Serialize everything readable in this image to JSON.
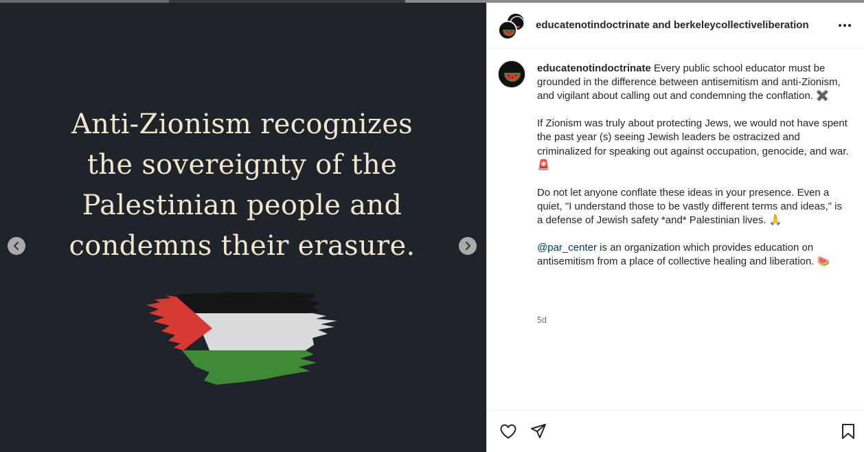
{
  "slide": {
    "quote_lines": [
      "Anti-Zionism recognizes",
      "the sovereignty of the",
      "Palestinian people and",
      "condemns their erasure."
    ],
    "flag_icon": "palestine-flag-brush-icon",
    "colors": {
      "background": "#1f232a",
      "quote_text": "#f3e6cf",
      "flag_black": "#151515",
      "flag_white": "#d9dadb",
      "flag_green": "#3f8a36",
      "flag_red": "#d63a33"
    }
  },
  "nav": {
    "prev_icon": "chevron-left-icon",
    "next_icon": "chevron-right-icon"
  },
  "header": {
    "user1": "educatenotindoctrinate",
    "connector": "and",
    "user2": "berkeleycollectiveliberation",
    "more_icon": "more-options-icon"
  },
  "caption": {
    "username": "educatenotindoctrinate",
    "p1_text": "Every public school educator must be grounded in the difference between antisemitism and anti-Zionism, and vigilant about calling out and condemning the conflation.",
    "p1_emoji": "✖️",
    "p2_text": "If Zionism was truly about protecting Jews, we would not have spent the past year (s) seeing Jewish leaders be ostracized and criminalized for speaking out against occupation, genocide, and war.",
    "p2_emoji": "🚨",
    "p3_text": "Do not let anyone conflate these ideas in your presence. Even a quiet, \"I understand those to be vastly different terms and ideas,\" is a defense of Jewish safety *and* Palestinian lives.",
    "p3_emoji": "🙏",
    "p4_mention": "@par_center",
    "p4_text": "is an organization which provides education on antisemitism from a place of collective healing and liberation.",
    "p4_emoji": "🍉",
    "timestamp": "5d"
  },
  "actions": {
    "like_icon": "heart-icon",
    "share_icon": "paper-plane-icon",
    "save_icon": "bookmark-icon"
  },
  "colors": {
    "text": "#262626",
    "muted": "#737373",
    "link": "#00376b"
  }
}
